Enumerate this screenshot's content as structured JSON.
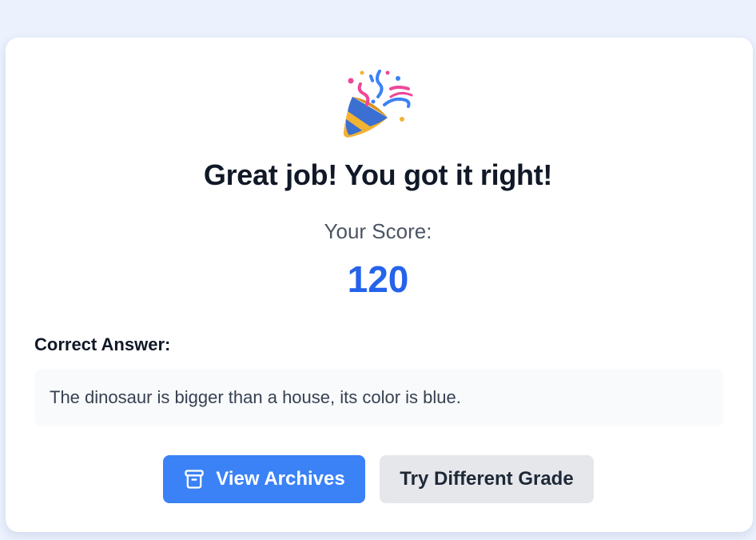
{
  "result": {
    "icon": "party-popper-icon",
    "headline": "Great job! You got it right!",
    "score_label": "Your Score:",
    "score_value": "120"
  },
  "answer": {
    "heading": "Correct Answer:",
    "text": "The dinosaur is bigger than a house, its color is blue."
  },
  "actions": {
    "view_archives_label": "View Archives",
    "view_archives_icon": "archive-box-icon",
    "try_different_grade_label": "Try Different Grade"
  },
  "colors": {
    "page_background": "#ebf1fd",
    "score_accent": "#2563eb",
    "primary_button": "#3b82f6",
    "secondary_button": "#e5e7eb"
  }
}
